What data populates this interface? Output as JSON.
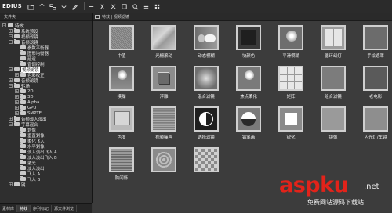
{
  "app": {
    "name": "EDIUS"
  },
  "left_panel": {
    "header": "文件夹",
    "tree": [
      {
        "label": "特效",
        "indent": 0,
        "exp": "−",
        "folder": true,
        "sel": false
      },
      {
        "label": "系统预设",
        "indent": 1,
        "exp": "+",
        "folder": true,
        "sel": false
      },
      {
        "label": "视频滤镜",
        "indent": 1,
        "exp": "−",
        "folder": true,
        "sel": false
      },
      {
        "label": "音频滤镜",
        "indent": 1,
        "exp": "−",
        "folder": true,
        "sel": false
      },
      {
        "label": "参数平衡器",
        "indent": 2,
        "exp": "",
        "folder": true,
        "sel": false
      },
      {
        "label": "图形均衡器",
        "indent": 2,
        "exp": "",
        "folder": true,
        "sel": false
      },
      {
        "label": "延迟",
        "indent": 2,
        "exp": "",
        "folder": true,
        "sel": false
      },
      {
        "label": "音调控制",
        "indent": 2,
        "exp": "",
        "folder": true,
        "sel": false
      },
      {
        "label": "视频滤镜",
        "indent": 1,
        "exp": "−",
        "folder": true,
        "sel": true
      },
      {
        "label": "色彩校正",
        "indent": 2,
        "exp": "+",
        "folder": true,
        "sel": false
      },
      {
        "label": "音频滤镜",
        "indent": 1,
        "exp": "+",
        "folder": true,
        "sel": false
      },
      {
        "label": "转场",
        "indent": 1,
        "exp": "−",
        "folder": true,
        "sel": false
      },
      {
        "label": "2D",
        "indent": 2,
        "exp": "+",
        "folder": true,
        "sel": false
      },
      {
        "label": "3D",
        "indent": 2,
        "exp": "+",
        "folder": true,
        "sel": false
      },
      {
        "label": "Alpha",
        "indent": 2,
        "exp": "+",
        "folder": true,
        "sel": false
      },
      {
        "label": "GPU",
        "indent": 2,
        "exp": "+",
        "folder": true,
        "sel": false
      },
      {
        "label": "SMPTE",
        "indent": 2,
        "exp": "+",
        "folder": true,
        "sel": false
      },
      {
        "label": "音频淡入淡出",
        "indent": 1,
        "exp": "+",
        "folder": true,
        "sel": false
      },
      {
        "label": "字幕混合",
        "indent": 1,
        "exp": "−",
        "folder": true,
        "sel": false
      },
      {
        "label": "划像",
        "indent": 2,
        "exp": "",
        "folder": true,
        "sel": false
      },
      {
        "label": "垂直划像",
        "indent": 2,
        "exp": "",
        "folder": true,
        "sel": false
      },
      {
        "label": "柔化飞入",
        "indent": 2,
        "exp": "",
        "folder": true,
        "sel": false
      },
      {
        "label": "水平划像",
        "indent": 2,
        "exp": "",
        "folder": true,
        "sel": false
      },
      {
        "label": "淡入淡出飞入 A",
        "indent": 2,
        "exp": "",
        "folder": true,
        "sel": false
      },
      {
        "label": "淡入淡出飞入 B",
        "indent": 2,
        "exp": "",
        "folder": true,
        "sel": false
      },
      {
        "label": "激光",
        "indent": 2,
        "exp": "",
        "folder": true,
        "sel": false
      },
      {
        "label": "淡入淡出",
        "indent": 2,
        "exp": "",
        "folder": true,
        "sel": false
      },
      {
        "label": "飞入 A",
        "indent": 2,
        "exp": "",
        "folder": true,
        "sel": false
      },
      {
        "label": "飞入 B",
        "indent": 2,
        "exp": "",
        "folder": true,
        "sel": false
      },
      {
        "label": "键",
        "indent": 1,
        "exp": "+",
        "folder": true,
        "sel": false
      }
    ]
  },
  "bottom_tabs": [
    "素材库",
    "特效",
    "序列标记",
    "源文件浏览"
  ],
  "right_panel": {
    "breadcrumb": "特效 | 视频滤镜",
    "tiles": [
      {
        "label": "中值",
        "thumb": "th-noise",
        "icon": "median-filter-icon"
      },
      {
        "label": "光栅滚动",
        "thumb": "th-bluewave",
        "icon": "raster-scroll-icon"
      },
      {
        "label": "动态模糊",
        "thumb": "th-motion",
        "icon": "motion-blur-icon"
      },
      {
        "label": "块颜色",
        "thumb": "th-block",
        "icon": "block-color-icon"
      },
      {
        "label": "平滑模糊",
        "thumb": "th-blurball",
        "icon": "smooth-blur-icon"
      },
      {
        "label": "循环幻灯",
        "thumb": "th-grid4",
        "icon": "loop-slide-icon"
      },
      {
        "label": "手绘遮罩",
        "thumb": "th-curve",
        "icon": "hand-drawn-mask-icon"
      },
      {
        "label": "模糊",
        "thumb": "th-gradball",
        "icon": "blur-icon"
      },
      {
        "label": "浮雕",
        "thumb": "th-emboss",
        "icon": "emboss-icon"
      },
      {
        "label": "混合滤镜",
        "thumb": "th-mix",
        "icon": "mix-filter-icon"
      },
      {
        "label": "焦点柔化",
        "thumb": "th-softball",
        "icon": "focus-soften-icon"
      },
      {
        "label": "矩阵",
        "thumb": "th-matrix",
        "icon": "matrix-icon"
      },
      {
        "label": "组合滤镜",
        "thumb": "th-stack",
        "icon": "combine-filter-icon"
      },
      {
        "label": "老电影",
        "thumb": "th-reel",
        "icon": "old-film-icon"
      },
      {
        "label": "色度",
        "thumb": "th-color",
        "icon": "chroma-icon"
      },
      {
        "label": "视频噪声",
        "thumb": "th-videonoise",
        "icon": "video-noise-icon"
      },
      {
        "label": "选择滤镜",
        "thumb": "th-selective",
        "icon": "selective-filter-icon"
      },
      {
        "label": "铅笔画",
        "thumb": "th-halfmoon",
        "icon": "pencil-sketch-icon"
      },
      {
        "label": "锐化",
        "thumb": "th-square",
        "icon": "sharpen-icon"
      },
      {
        "label": "镜像",
        "thumb": "th-mirror",
        "icon": "mirror-icon"
      },
      {
        "label": "闪光灯/车镜",
        "thumb": "th-strobe",
        "icon": "strobe-icon"
      },
      {
        "label": "防闪烁",
        "thumb": "th-antialias",
        "icon": "anti-flicker-icon"
      },
      {
        "label": "",
        "thumb": "th-ripple",
        "icon": "ripple-icon"
      },
      {
        "label": "",
        "thumb": "th-mosaic",
        "icon": "mosaic-icon"
      }
    ]
  },
  "watermark": {
    "brand": "aspku",
    "net": ".net",
    "sub": "免费网站源码下载站"
  },
  "colors": {
    "watermark_red": "#e2231a",
    "panel_bg": "#3c3c3c",
    "tree_bg": "#2f2f2f",
    "selection": "#ffffff"
  }
}
